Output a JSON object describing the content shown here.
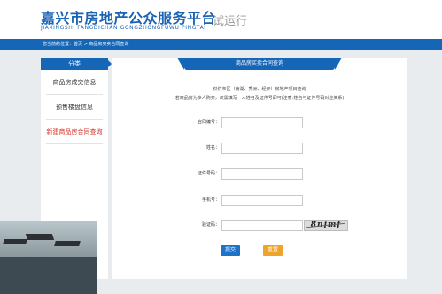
{
  "header": {
    "title": "嘉兴市房地产公众服务平台",
    "subtitle": "JIAXINGSHI FANGDICHAN GONGZHONGFUWU PINGTAI",
    "trial": "试运行"
  },
  "breadcrumb": "您当前的位置：首页 > 商品房买卖合同查询",
  "sidebar": {
    "heading": "分类",
    "items": [
      {
        "label": "商品房成交信息"
      },
      {
        "label": "预售楼盘信息"
      },
      {
        "label": "新建商品房合同查询",
        "active": true
      }
    ]
  },
  "main": {
    "tab_title": "商品房买卖合同查询",
    "notice_line1": "仅供市区（南湖、秀洲、经开）房地产项目查询",
    "notice_line2": "若商品房为多人购买，仅需填写一人姓名及证件号即可(注意:姓名与证件号码对应关系)",
    "fields": {
      "contract_no": {
        "label": "合同编号：",
        "value": ""
      },
      "name": {
        "label": "姓名：",
        "value": ""
      },
      "id_no": {
        "label": "证件号码：",
        "value": ""
      },
      "phone": {
        "label": "手机号：",
        "value": ""
      },
      "captcha": {
        "label": "验证码：",
        "value": "",
        "image_text": "8njmf"
      }
    },
    "submit_label": "提交",
    "reset_label": "重置"
  },
  "colors": {
    "brand_blue": "#1666b8",
    "active_red": "#d9342b",
    "submit_blue": "#1e73c9",
    "reset_orange": "#f0a32a"
  }
}
